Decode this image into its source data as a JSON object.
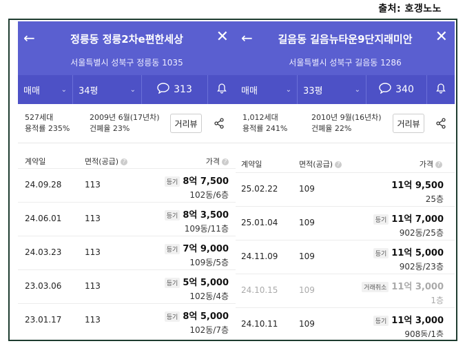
{
  "source": "출처: 호갱노노",
  "panels": [
    {
      "title": "정릉동 정릉2차e편한세상",
      "address": "서울특별시 성북구 정릉동 1035",
      "tabs": {
        "trade": "매매",
        "size": "34평",
        "comments": "313"
      },
      "info": {
        "households": "527세대",
        "floor_ratio": "용적률 235%",
        "built": "2009년 6월(17년차)",
        "coverage": "건폐율 23%"
      },
      "street_view": "거리뷰",
      "columns": {
        "date": "계약일",
        "area": "면적(공급)",
        "price": "가격"
      },
      "rows": [
        {
          "date": "24.09.28",
          "area": "113",
          "badge": "등기",
          "price": "8억 7,500",
          "floor": "102동/6층"
        },
        {
          "date": "24.06.01",
          "area": "113",
          "badge": "등기",
          "price": "8억 3,500",
          "floor": "109동/11층"
        },
        {
          "date": "24.03.23",
          "area": "113",
          "badge": "등기",
          "price": "7억 9,000",
          "floor": "109동/5층"
        },
        {
          "date": "23.03.06",
          "area": "113",
          "badge": "등기",
          "price": "5억 5,000",
          "floor": "102동/4층"
        },
        {
          "date": "23.01.17",
          "area": "113",
          "badge": "등기",
          "price": "8억 5,000",
          "floor": "102동/7층"
        }
      ]
    },
    {
      "title": "길음동 길음뉴타운9단지래미안",
      "address": "서울특별시 성북구 길음동 1286",
      "tabs": {
        "trade": "매매",
        "size": "33평",
        "comments": "340"
      },
      "info": {
        "households": "1,012세대",
        "floor_ratio": "용적률 241%",
        "built": "2010년 9월(16년차)",
        "coverage": "건폐율 22%"
      },
      "street_view": "거리뷰",
      "columns": {
        "date": "계약일",
        "area": "면적(공급)",
        "price": "가격"
      },
      "rows": [
        {
          "date": "25.02.22",
          "area": "109",
          "badge": "",
          "price": "11억 9,500",
          "floor": "25층"
        },
        {
          "date": "25.01.04",
          "area": "109",
          "badge": "등기",
          "price": "11억 7,000",
          "floor": "902동/25층"
        },
        {
          "date": "24.11.09",
          "area": "109",
          "badge": "등기",
          "price": "11억 5,000",
          "floor": "902동/23층"
        },
        {
          "date": "24.10.15",
          "area": "109",
          "badge": "거래취소",
          "price": "11억 3,000",
          "floor": "1층",
          "cancelled": true
        },
        {
          "date": "24.10.11",
          "area": "109",
          "badge": "등기",
          "price": "11억 3,000",
          "floor": "908동/1층"
        }
      ]
    }
  ]
}
